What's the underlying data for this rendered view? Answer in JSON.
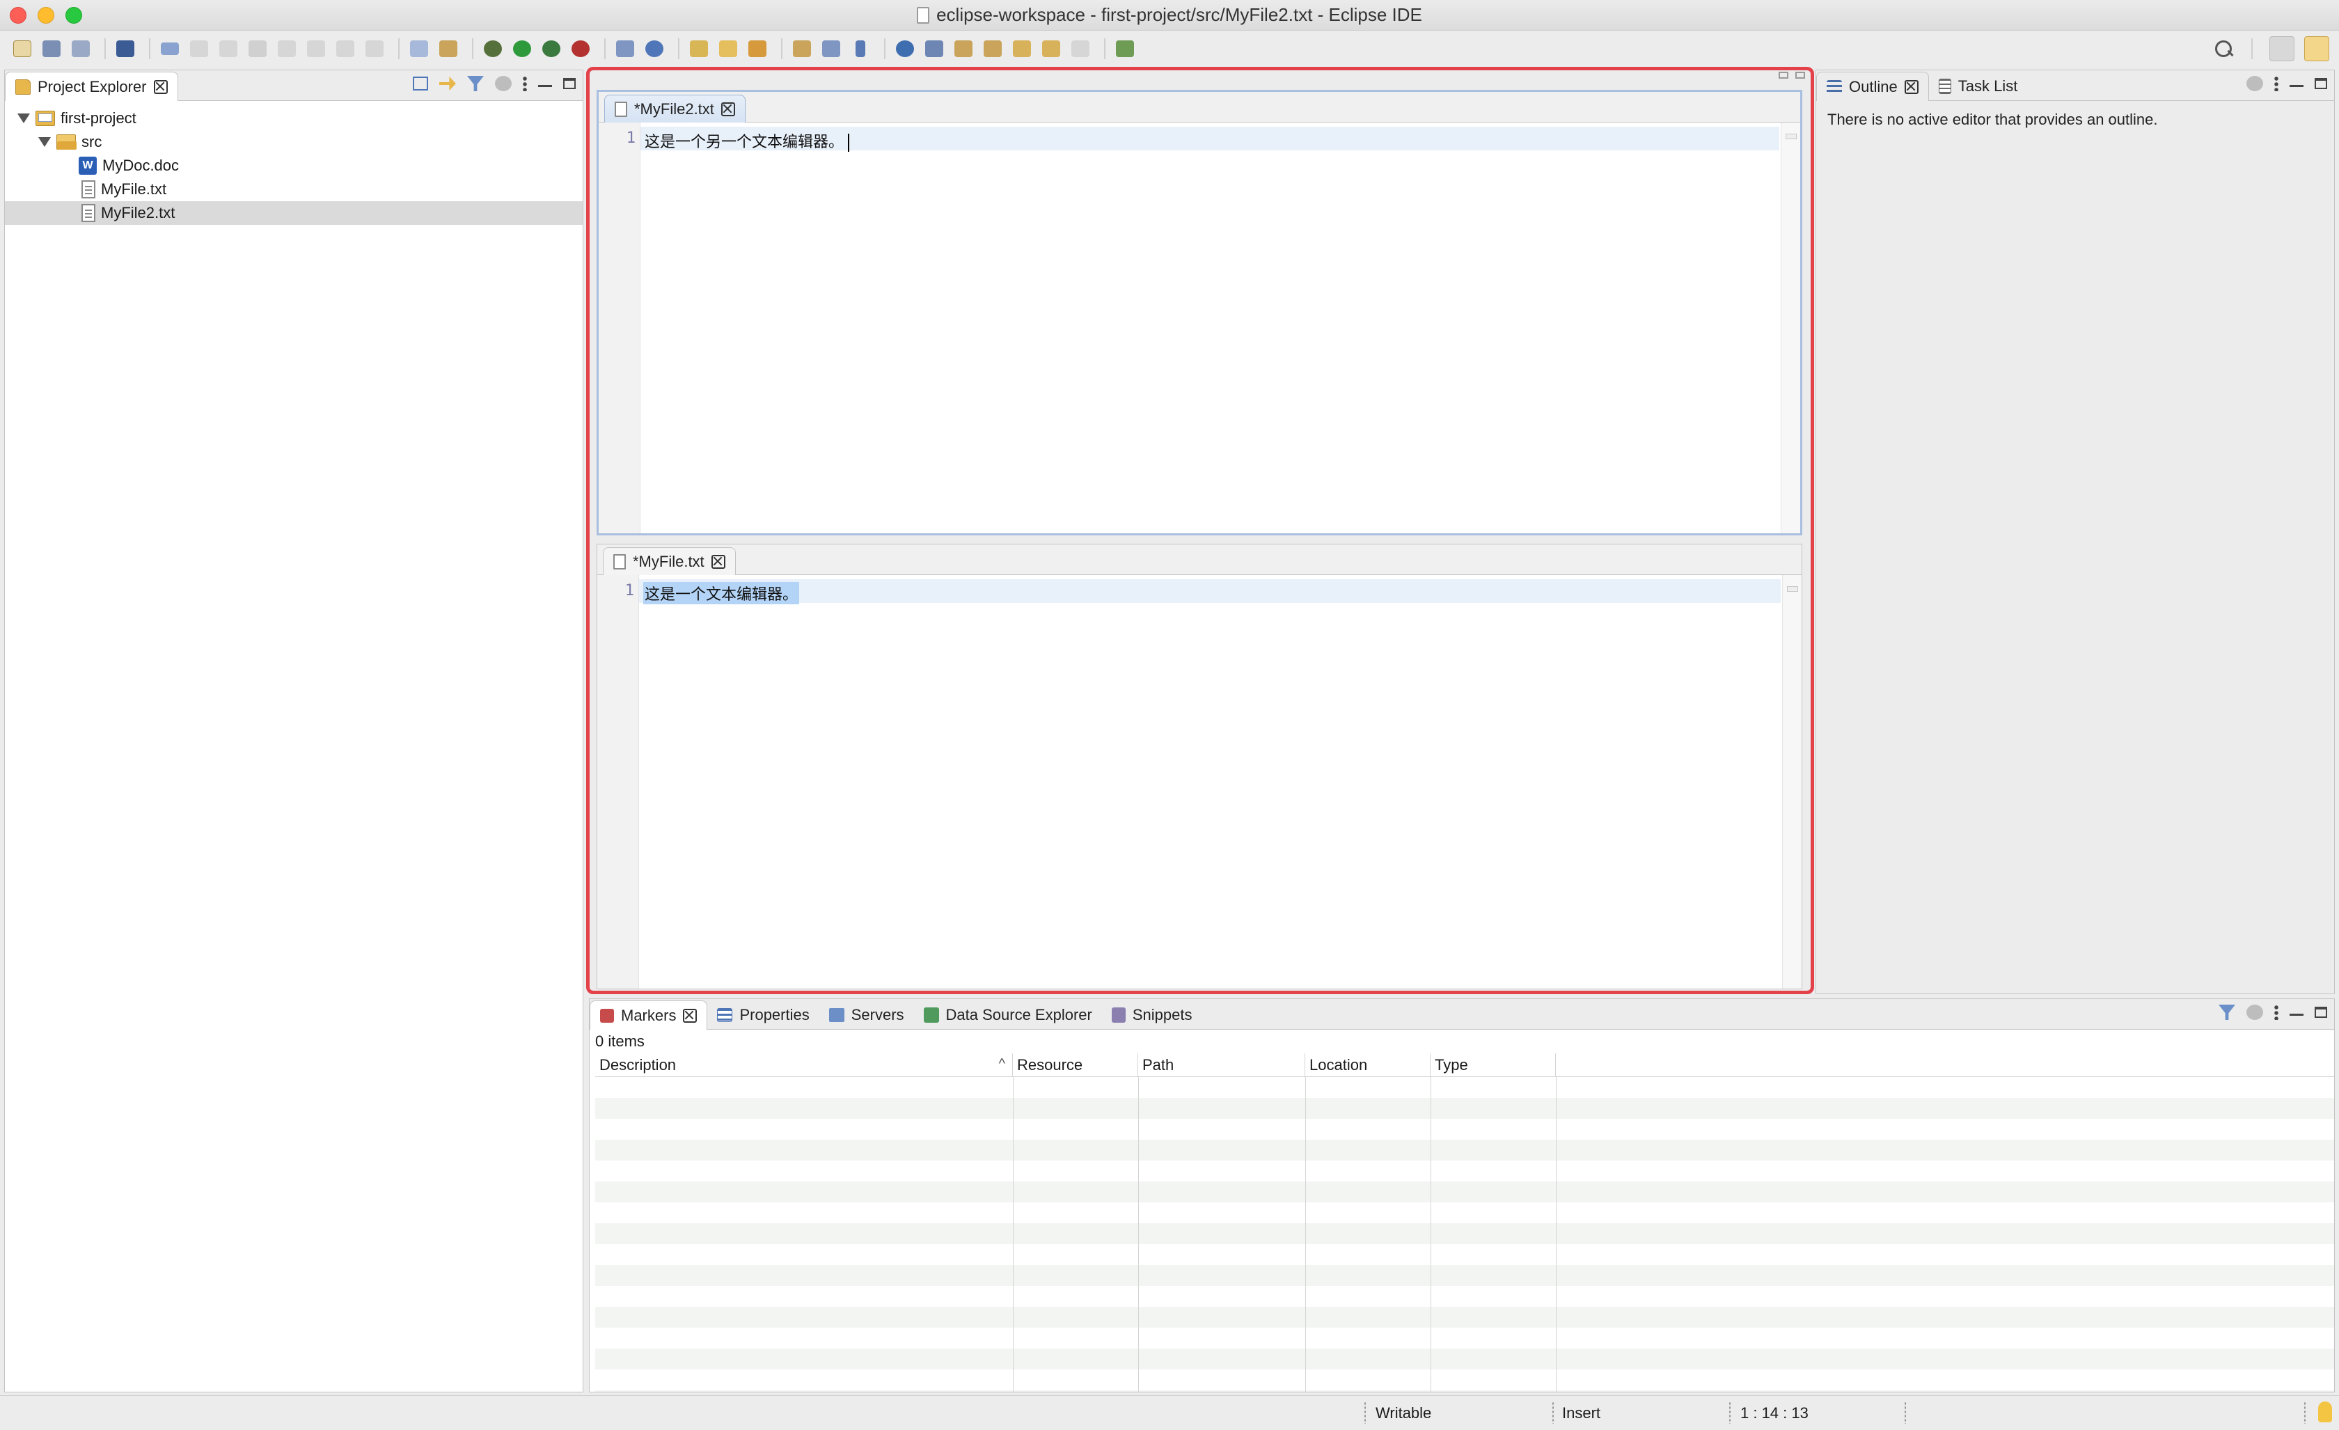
{
  "window": {
    "title": "eclipse-workspace - first-project/src/MyFile2.txt - Eclipse IDE"
  },
  "toolbar": {
    "icons": [
      "new-icon",
      "save-icon",
      "save-all-icon",
      "terminal-icon",
      "skip-breakpoints-icon",
      "resume-icon",
      "suspend-icon",
      "terminate-icon",
      "disconnect-icon",
      "step-into-icon",
      "step-over-icon",
      "step-return-icon",
      "toggle-block-icon",
      "clear-icon",
      "debug-icon",
      "run-icon",
      "coverage-icon",
      "external-tools-icon",
      "new-server-icon",
      "open-type-icon",
      "open-task-icon",
      "open-resource-icon",
      "annotation-icon",
      "toggle-mark-icon",
      "block-selection-icon",
      "show-whitespace-icon",
      "web-browser-icon",
      "search-marker-icon",
      "next-annotation-icon",
      "prev-annotation-icon",
      "back-icon",
      "forward-icon",
      "pin-editor-icon"
    ],
    "accent": "#4e76b8"
  },
  "project_explorer": {
    "title": "Project Explorer",
    "tree": [
      {
        "label": "first-project",
        "icon": "project-icon",
        "level": 0
      },
      {
        "label": "src",
        "icon": "folder-icon",
        "level": 1
      },
      {
        "label": "MyDoc.doc",
        "icon": "word-doc-icon",
        "level": 2
      },
      {
        "label": "MyFile.txt",
        "icon": "text-file-icon",
        "level": 2
      },
      {
        "label": "MyFile2.txt",
        "icon": "text-file-icon",
        "level": 2,
        "selected": true
      }
    ]
  },
  "editors": {
    "top": {
      "tab_label": "*MyFile2.txt",
      "line_number": "1",
      "content": "这是一个另一个文本编辑器。"
    },
    "bottom": {
      "tab_label": "*MyFile.txt",
      "line_number": "1",
      "content": "这是一个文本编辑器。"
    },
    "highlight_color": "#e4424b"
  },
  "outline": {
    "tabs": [
      "Outline",
      "Task List"
    ],
    "message": "There is no active editor that provides an outline."
  },
  "markers": {
    "tabs": [
      "Markers",
      "Properties",
      "Servers",
      "Data Source Explorer",
      "Snippets"
    ],
    "count": "0 items",
    "columns": [
      "Description",
      "Resource",
      "Path",
      "Location",
      "Type"
    ]
  },
  "status": {
    "writable": "Writable",
    "mode": "Insert",
    "position": "1 : 14 : 13"
  }
}
